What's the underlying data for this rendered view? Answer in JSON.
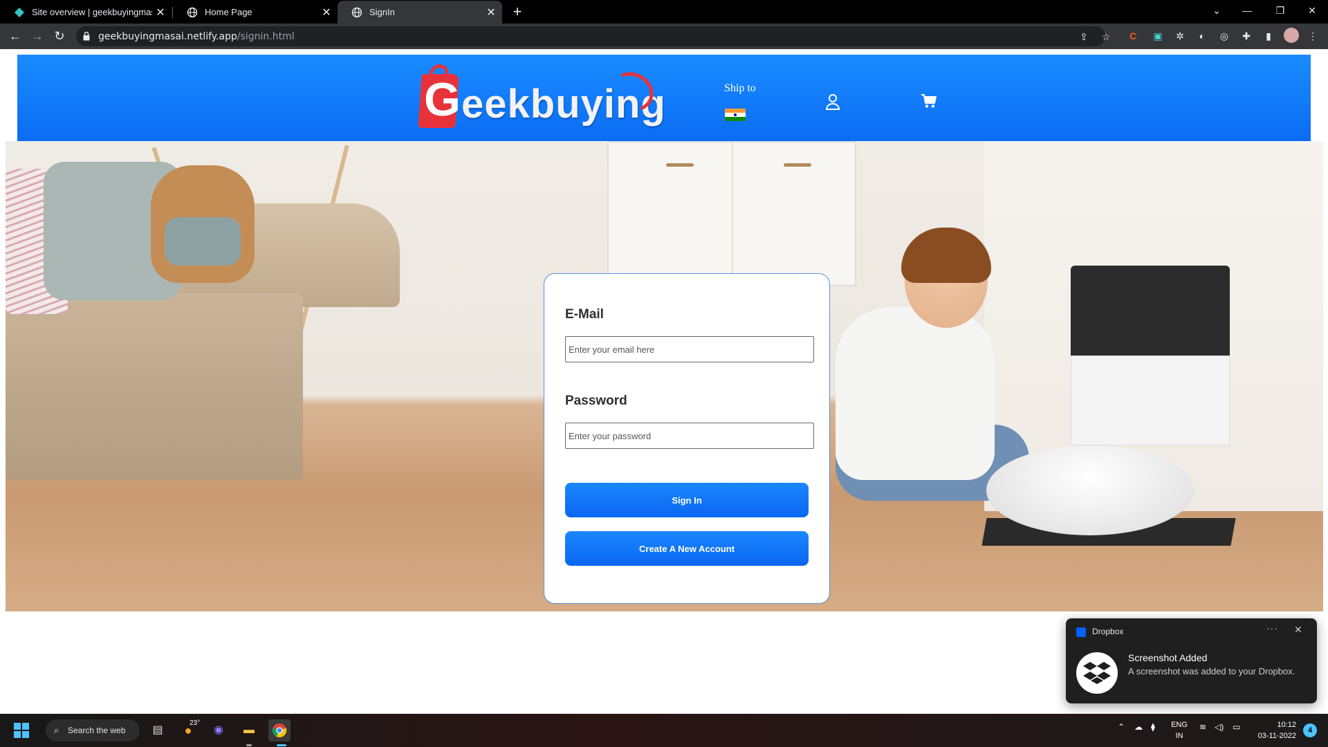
{
  "browser": {
    "tabs": [
      {
        "title": "Site overview | geekbuyingmasai",
        "close": "✕",
        "icon": "netlify-icon"
      },
      {
        "title": "Home Page",
        "close": "✕",
        "icon": "globe-icon"
      },
      {
        "title": "SignIn",
        "close": "✕",
        "icon": "globe-icon"
      }
    ],
    "active_tab": 2,
    "new_tab": "+",
    "address": {
      "host": "geekbuyingmasai.netlify.app",
      "path": "/signin.html"
    }
  },
  "header": {
    "logo_first_letter": "G",
    "logo_rest": "eekbuying",
    "ship_to": "Ship to",
    "flag_colors": [
      "#ff9933",
      "#ffffff",
      "#138808"
    ],
    "icons": [
      "user-icon",
      "cart-icon"
    ]
  },
  "signin": {
    "email_label": "E-Mail",
    "email_placeholder": "Enter your email here",
    "password_label": "Password",
    "password_placeholder": "Enter your password",
    "signin_button": "Sign In",
    "create_button": "Create A New Account"
  },
  "toast": {
    "app": "Dropbox",
    "more": "···",
    "close": "✕",
    "title": "Screenshot Added",
    "body": "A screenshot was added to your Dropbox."
  },
  "taskbar": {
    "search": "Search the web",
    "weather": "23°",
    "lang_line1": "ENG",
    "lang_line2": "IN",
    "time": "10:12",
    "date": "03-11-2022",
    "notifications": "4"
  },
  "colors": {
    "header_blue": "#0b6cf5",
    "button_blue": "#1a87ff",
    "logo_red": "#e8323a"
  }
}
